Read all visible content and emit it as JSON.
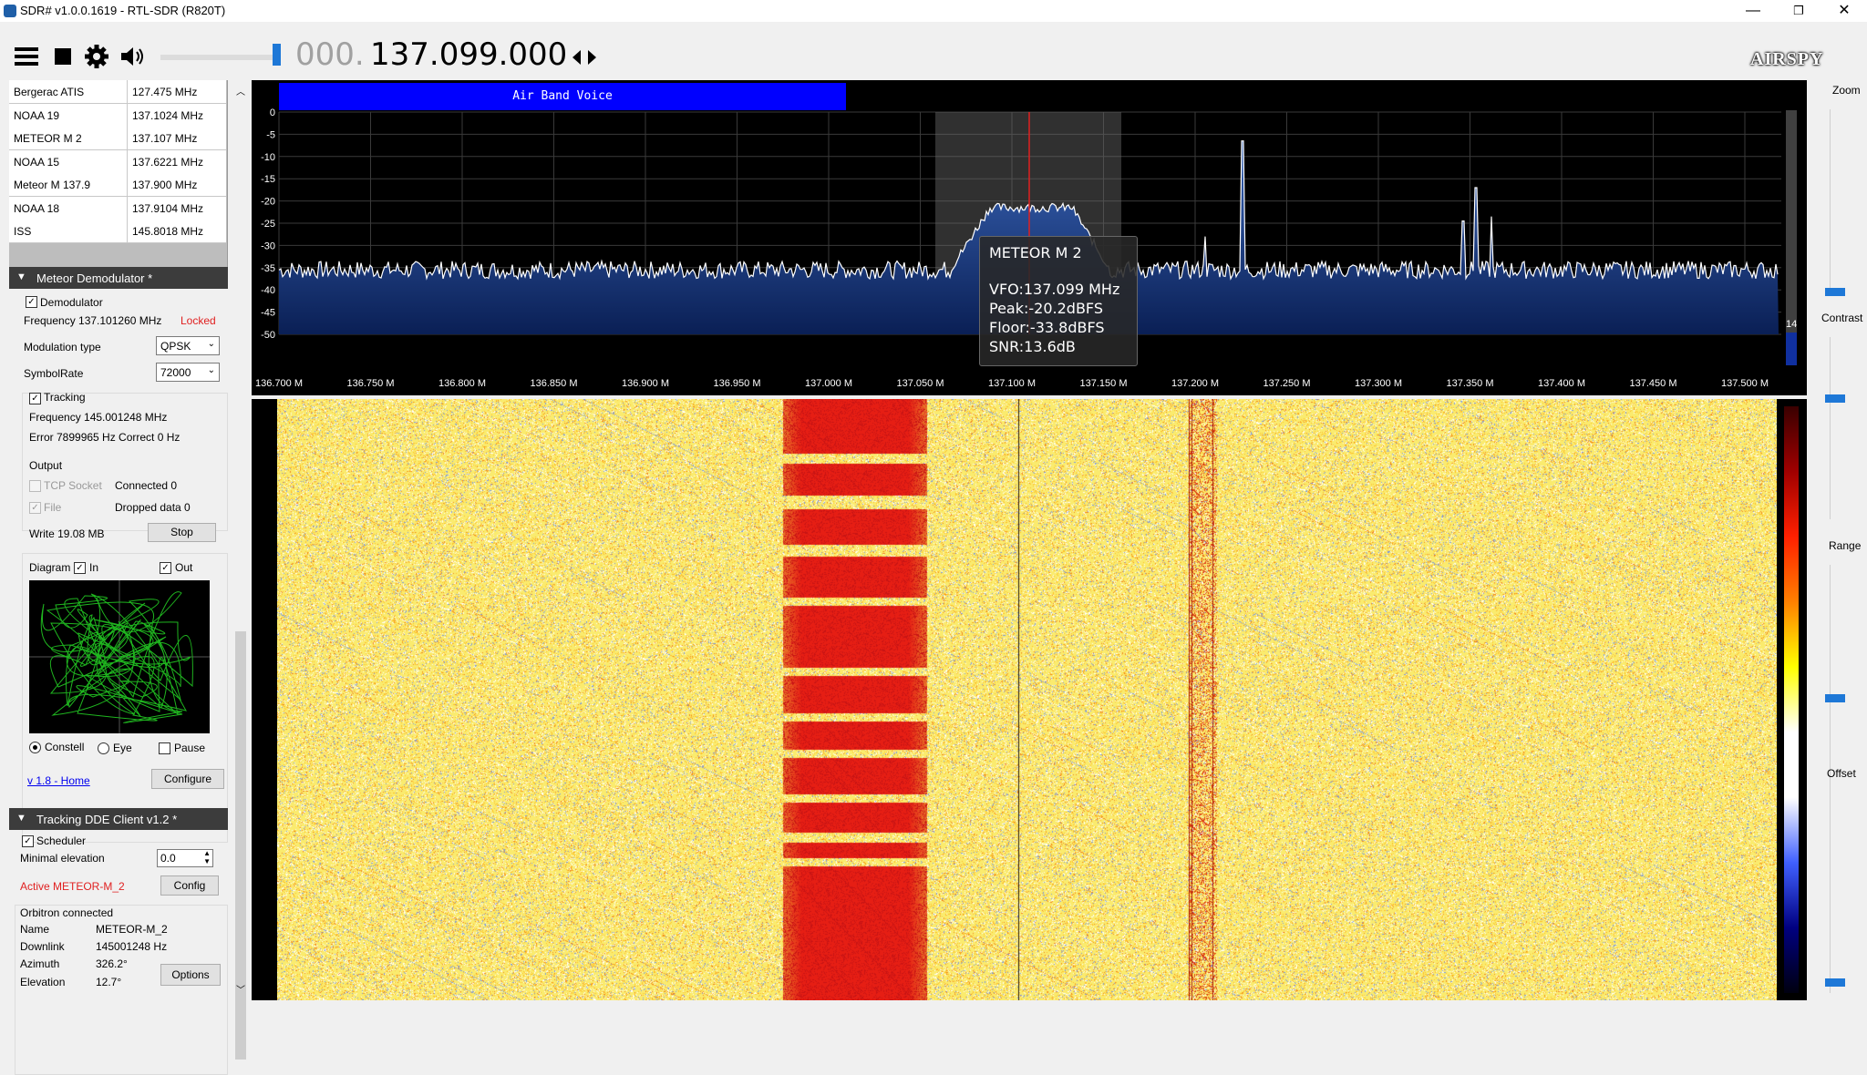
{
  "window": {
    "title": "SDR# v1.0.0.1619 - RTL-SDR (R820T)",
    "min_glyph": "—",
    "max_glyph": "❐",
    "close_glyph": "✕"
  },
  "toolbar": {
    "freq_dim": "000.",
    "freq_main": "137.099.000",
    "logo": "AIRSPY",
    "icons": [
      "menu-icon",
      "stop-icon",
      "gear-icon",
      "speaker-icon",
      "tune-arrows-icon"
    ]
  },
  "frequency_list": [
    {
      "name": "Bergerac ATIS",
      "freq": "127.475 MHz"
    },
    {
      "name": "NOAA 19",
      "freq": "137.1024 MHz"
    },
    {
      "name": "METEOR M 2",
      "freq": "137.107 MHz"
    },
    {
      "name": "NOAA 15",
      "freq": "137.6221 MHz"
    },
    {
      "name": "Meteor M 137.9",
      "freq": "137.900 MHz"
    },
    {
      "name": "NOAA 18",
      "freq": "137.9104 MHz"
    },
    {
      "name": "ISS",
      "freq": "145.8018 MHz"
    }
  ],
  "meteor": {
    "header": "Meteor Demodulator *",
    "demod_label": "Demodulator",
    "frequency": "Frequency 137.101260 MHz",
    "locked": "Locked",
    "mod_label": "Modulation type",
    "mod_value": "QPSK",
    "symrate_label": "SymbolRate",
    "symrate_value": "72000",
    "tracking_label": "Tracking",
    "tracking_freq": "Frequency 145.001248 MHz",
    "tracking_err": "Error 7899965 Hz  Correct 0 Hz",
    "output_label": "Output",
    "tcp_label": "TCP Socket",
    "connected": "Connected 0",
    "file_label": "File",
    "dropped": "Dropped data 0",
    "write": "Write 19.08 MB",
    "stop": "Stop",
    "diagram_label": "Diagram",
    "in_label": "In",
    "out_label": "Out",
    "constell": "Constell",
    "eye": "Eye",
    "pause": "Pause",
    "version": "v 1.8 - Home",
    "configure": "Configure"
  },
  "tracking": {
    "header": "Tracking DDE Client v1.2 *",
    "scheduler": "Scheduler",
    "min_elev_label": "Minimal elevation",
    "min_elev_value": "0.0",
    "active": "Active METEOR-M_2",
    "config": "Config",
    "orbitron": "Orbitron connected",
    "name_label": "Name",
    "name_value": "METEOR-M_2",
    "downlink_label": "Downlink",
    "downlink_value": "145001248 Hz",
    "azimuth_label": "Azimuth",
    "azimuth_value": "326.2°",
    "elevation_label": "Elevation",
    "elevation_value": "12.7°",
    "options": "Options"
  },
  "spectrum": {
    "band_label": "Air Band Voice",
    "y_ticks": [
      "0",
      "-5",
      "-10",
      "-15",
      "-20",
      "-25",
      "-30",
      "-35",
      "-40",
      "-45",
      "-50"
    ],
    "x_ticks": [
      "136.700 M",
      "136.750 M",
      "136.800 M",
      "136.850 M",
      "136.900 M",
      "136.950 M",
      "137.000 M",
      "137.050 M",
      "137.100 M",
      "137.150 M",
      "137.200 M",
      "137.250 M",
      "137.300 M",
      "137.350 M",
      "137.400 M",
      "137.450 M",
      "137.500 M"
    ],
    "tooltip": {
      "name": "METEOR M 2",
      "vfo": "VFO:137.099 MHz",
      "peak": "Peak:-20.2dBFS",
      "floor": "Floor:-33.8dBFS",
      "snr": "SNR:13.6dB"
    },
    "side_value": "14",
    "colors": {
      "band": "#0000ff",
      "signal": "#ffffff",
      "fill": "#1b3f8a",
      "vfo": "#e02020"
    }
  },
  "right_controls": {
    "zoom": "Zoom",
    "contrast": "Contrast",
    "range": "Range",
    "offset": "Offset"
  }
}
